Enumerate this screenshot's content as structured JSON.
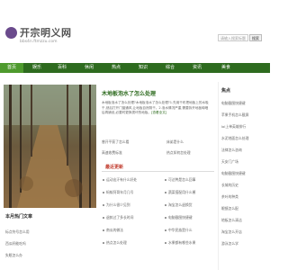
{
  "site": {
    "title": "开宗明义网",
    "url": "bbs4n.ftmzzu.com"
  },
  "search": {
    "placeholder": "请输入搜索标题",
    "button_label": "搜索"
  },
  "nav": {
    "items": [
      "首页",
      "娱乐",
      "百科",
      "休闲",
      "热点",
      "知识",
      "综合",
      "资讯",
      "美食"
    ]
  },
  "article": {
    "title": "木地板泡水了怎么处理",
    "body": "木地板泡水了怎么处理?木地板泡水了怎么处理?1.先用干布把地板上的水吸干,然后打开门窗通风,让地板自然阴干。2.泡水情况严重,需要拆开地板晾晒后再铺设,必要时更换损坏的地板。",
    "link_label": "[查看全文]"
  },
  "related": [
    "曾开平获了怎么看",
    "床弟是什么",
    "高速收费标准",
    "热点如何怎处理"
  ],
  "latest": {
    "title": "最近更新",
    "items": [
      "运动出汗有什么好处",
      "可达鸭是怎么回事",
      "蚂蚁阿哥年月几号",
      "蔬菜搭配用什么酱",
      "为什么很少见到",
      "淘宝怎么退换货",
      "退款过了多长时间",
      "电脑截图快捷键",
      "南瓜的做法",
      "中华民族是什么",
      "热点怎么处理",
      "水果都有哪些水果"
    ]
  },
  "left_box": {
    "title": "本月热门文章",
    "items": [
      "标点符号怎么用",
      "西瓜籽能吃吗",
      "失眠怎么办"
    ]
  },
  "sidebar": {
    "title": "焦点",
    "items": [
      "电脑截图快捷键",
      "苹果手机怎么截屏",
      "lol上单英雄排行",
      "水泥地面怎么处理",
      "法律怎么咨询",
      "天安门广场",
      "电脑截图快捷键",
      "长城的历史",
      "茶叶的种类",
      "眼镜怎么配",
      "地板怎么清洁",
      "淘宝怎么开店",
      "游泳怎么学"
    ]
  }
}
